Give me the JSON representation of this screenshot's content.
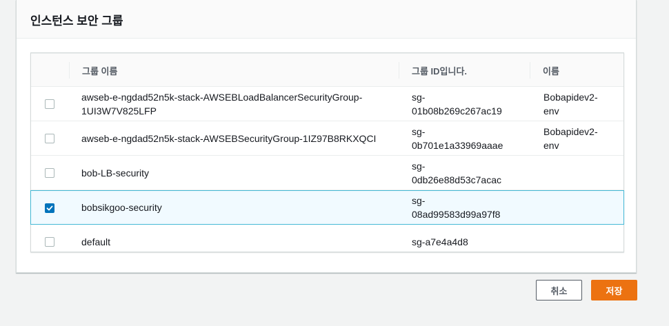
{
  "panel": {
    "title": "인스턴스 보안 그룹"
  },
  "table": {
    "headers": {
      "group_name": "그룹 이름",
      "group_id": "그룹 ID입니다.",
      "name": "이름"
    },
    "rows": [
      {
        "group_name": [
          "awseb-e-ngdad52n5k-stack-AWSEBLoadBalancerSecurityGroup-",
          "1UI3W7V825LFP"
        ],
        "group_id": [
          "sg-",
          "01b08b269c267ac19"
        ],
        "name": [
          "Bobapidev2-",
          "env"
        ],
        "checked": false
      },
      {
        "group_name": [
          "awseb-e-ngdad52n5k-stack-AWSEBSecurityGroup-1IZ97B8RKXQCI"
        ],
        "group_id": [
          "sg-",
          "0b701e1a33969aaae"
        ],
        "name": [
          "Bobapidev2-",
          "env"
        ],
        "checked": false
      },
      {
        "group_name": [
          "bob-LB-security"
        ],
        "group_id": [
          "sg-",
          "0db26e88d53c7acac"
        ],
        "name": [],
        "checked": false
      },
      {
        "group_name": [
          "bobsikgoo-security"
        ],
        "group_id": [
          "sg-",
          "08ad99583d99a97f8"
        ],
        "name": [],
        "checked": true
      },
      {
        "group_name": [
          "default"
        ],
        "group_id": [
          "sg-a7e4a4d8"
        ],
        "name": [],
        "checked": false
      }
    ]
  },
  "buttons": {
    "cancel": "취소",
    "save": "저장"
  },
  "colors": {
    "accent": "#ec7211",
    "checkbox_checked": "#0073bb",
    "selected_row_border": "#44b9d6",
    "selected_row_bg": "#f1faff"
  },
  "icons": {
    "checkbox_checked": "check-icon"
  }
}
